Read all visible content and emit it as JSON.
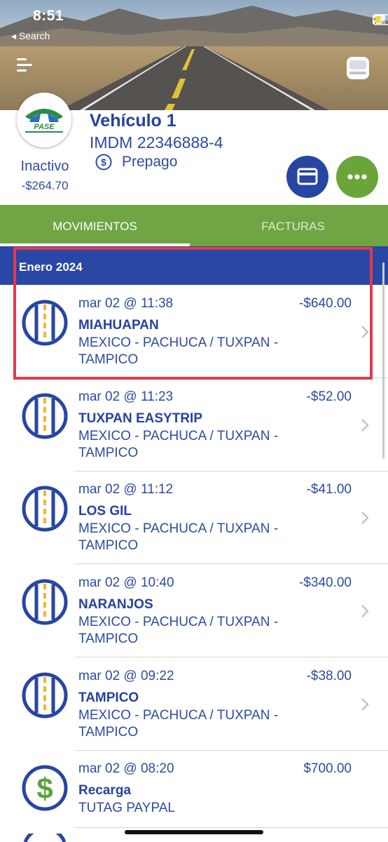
{
  "status_bar": {
    "time": "8:51",
    "back_label": "◂ Search"
  },
  "logo_text": "PASE",
  "vehicle": {
    "name": "Vehículo 1",
    "id": "IMDM 22346888-4",
    "plan": "Prepago",
    "status": "Inactivo",
    "balance": "-$264.70"
  },
  "tabs": [
    {
      "label": "MOVIMIENTOS",
      "active": true
    },
    {
      "label": "FACTURAS",
      "active": false
    }
  ],
  "month_header": "Enero 2024",
  "transactions": [
    {
      "icon": "road-icon",
      "when": "mar 02 @ 11:38",
      "amount": "-$640.00",
      "place": "MIAHUAPAN",
      "route": "MEXICO - PACHUCA / TUXPAN - TAMPICO"
    },
    {
      "icon": "road-icon",
      "when": "mar 02 @ 11:23",
      "amount": "-$52.00",
      "place": "TUXPAN EASYTRIP",
      "route": "MEXICO - PACHUCA / TUXPAN - TAMPICO"
    },
    {
      "icon": "road-icon",
      "when": "mar 02 @ 11:12",
      "amount": "-$41.00",
      "place": "LOS GIL",
      "route": "MEXICO - PACHUCA / TUXPAN - TAMPICO"
    },
    {
      "icon": "road-icon",
      "when": "mar 02 @ 10:40",
      "amount": "-$340.00",
      "place": "NARANJOS",
      "route": "MEXICO - PACHUCA / TUXPAN - TAMPICO"
    },
    {
      "icon": "road-icon",
      "when": "mar 02 @ 09:22",
      "amount": "-$38.00",
      "place": "TAMPICO",
      "route": "MEXICO - PACHUCA / TUXPAN - TAMPICO"
    },
    {
      "icon": "dollar-icon",
      "when": "mar 02 @ 08:20",
      "amount": "$700.00",
      "place": "Recarga",
      "route": "TUTAG PAYPAL"
    }
  ],
  "colors": {
    "brand_blue": "#2745a3",
    "brand_green": "#6fa543",
    "highlight_red": "#e3394a"
  }
}
